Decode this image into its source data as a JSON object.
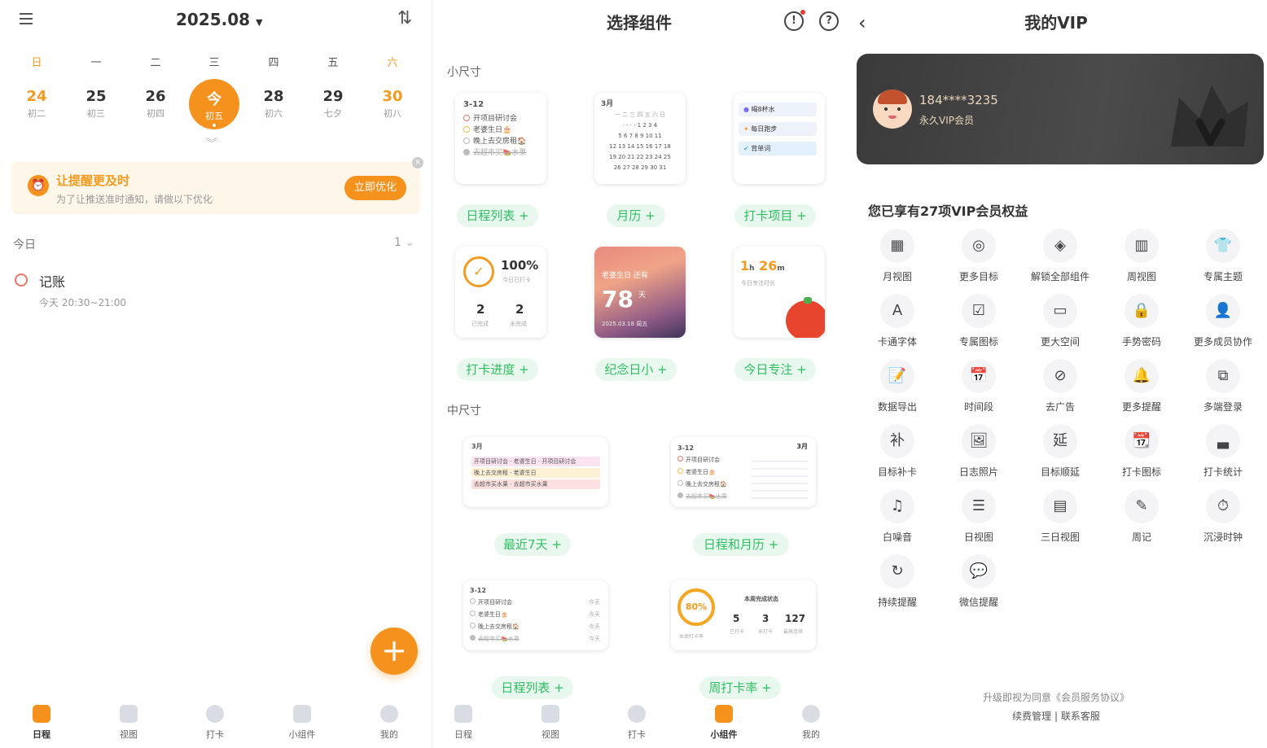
{
  "p1": {
    "month": "2025.08",
    "sort_icon": "sort-icon",
    "weekdays": [
      "日",
      "一",
      "二",
      "三",
      "四",
      "五",
      "六"
    ],
    "days": [
      {
        "n": "24",
        "l": "初二"
      },
      {
        "n": "25",
        "l": "初三"
      },
      {
        "n": "26",
        "l": "初四"
      },
      {
        "n": "今",
        "l": "初五"
      },
      {
        "n": "28",
        "l": "初六"
      },
      {
        "n": "29",
        "l": "七夕"
      },
      {
        "n": "30",
        "l": "初八"
      }
    ],
    "banner": {
      "title": "让提醒更及时",
      "sub": "为了让推送准时通知，请做以下优化",
      "btn": "立即优化"
    },
    "section": "今日",
    "count": "1",
    "task": {
      "title": "记账",
      "time": "今天 20:30~21:00"
    },
    "fab": "+",
    "tabs": [
      "日程",
      "视图",
      "打卡",
      "小组件",
      "我的"
    ]
  },
  "p2": {
    "title": "选择组件",
    "small": "小尺寸",
    "medium": "中尺寸",
    "help": "?",
    "alert": "!",
    "w_sched": {
      "date": "3-12",
      "items": [
        "开项目研讨会",
        "老婆生日🎂",
        "晚上去交房租🏠",
        "去超市买🍉水果"
      ]
    },
    "w_cal": {
      "month": "3月",
      "rows": [
        "一 二 三 四 五 六 日",
        "· · · · 1 2 3 4",
        "5 6 7 8 9 10 11",
        "12 13 14 15 16 17 18",
        "19 20 21 22 23 24 25",
        "26 27 28 29 30 31"
      ]
    },
    "w_check": {
      "items": [
        "喝8杯水",
        "每日跑步",
        "背单词"
      ]
    },
    "w_prog": {
      "pct": "100%",
      "sub": "今日已打卡",
      "a": "2",
      "al": "已完成",
      "b": "2",
      "bl": "未完成"
    },
    "w_memo": {
      "title": "老婆生日 还有",
      "num": "78",
      "unit": "天",
      "date": "2025.03.18 周五"
    },
    "w_focus": {
      "h": "1",
      "m": "26",
      "hu": "h",
      "mu": "m",
      "sub": "今日专注时长"
    },
    "w_week": {
      "month": "3月",
      "rows": [
        "开项目研讨会 · 老婆生日 · 开项目研讨会",
        "晚上去交房租 · 老婆生日",
        "去超市买水果 · 去超市买水果"
      ]
    },
    "w_sc": {
      "date": "3-12",
      "month": "3月",
      "items": [
        "开项目研讨会",
        "老婆生日🎂",
        "晚上去交房租🏠",
        "去超市买🍉水果"
      ]
    },
    "w_sched2": {
      "date": "3-12",
      "items": [
        "开项目研讨会",
        "老婆生日🎂",
        "晚上去交房租🏠",
        "去超市买🍉水果"
      ],
      "tag": "今天"
    },
    "w_rate": {
      "pct": "80%",
      "sub": "本周打卡率",
      "title": "本周完成状态",
      "a": "5",
      "al": "已打卡",
      "b": "3",
      "bl": "未打卡",
      "c": "127",
      "cl": "最高连续"
    },
    "btns": [
      "日程列表 +",
      "月历 +",
      "打卡项目 +",
      "打卡进度 +",
      "纪念日小 +",
      "今日专注 +",
      "最近7天 +",
      "日程和月历 +",
      "日程列表 +",
      "周打卡率 +"
    ],
    "tabs": [
      "日程",
      "视图",
      "打卡",
      "小组件",
      "我的"
    ]
  },
  "p3": {
    "title": "我的VIP",
    "back": "‹",
    "phone": "184****3235",
    "level": "永久VIP会员",
    "benefits_title": "您已享有27项VIP会员权益",
    "benefits": [
      "月视图",
      "更多目标",
      "解锁全部组件",
      "周视图",
      "专属主题",
      "卡通字体",
      "专属图标",
      "更大空间",
      "手势密码",
      "更多成员协作",
      "数据导出",
      "时间段",
      "去广告",
      "更多提醒",
      "多端登录",
      "目标补卡",
      "日志照片",
      "目标顺延",
      "打卡图标",
      "打卡统计",
      "白噪音",
      "日视图",
      "三日视图",
      "周记",
      "沉浸时钟",
      "持续提醒",
      "微信提醒"
    ],
    "benefit_glyphs": [
      "▦",
      "◎",
      "◈",
      "▥",
      "👕",
      "A",
      "☑",
      "▭",
      "🔒",
      "👤",
      "📝",
      "📅",
      "⊘",
      "🔔",
      "⧉",
      "补",
      "🖼",
      "延",
      "📆",
      "▃",
      "♫",
      "☰",
      "▤",
      "✎",
      "⏱",
      "↻",
      "💬"
    ],
    "foot1": "升级即视为同意《会员服务协议》",
    "foot2": "续费管理 | 联系客服"
  },
  "colors": {
    "accent": "#f5921e",
    "green": "#2fbf63"
  }
}
